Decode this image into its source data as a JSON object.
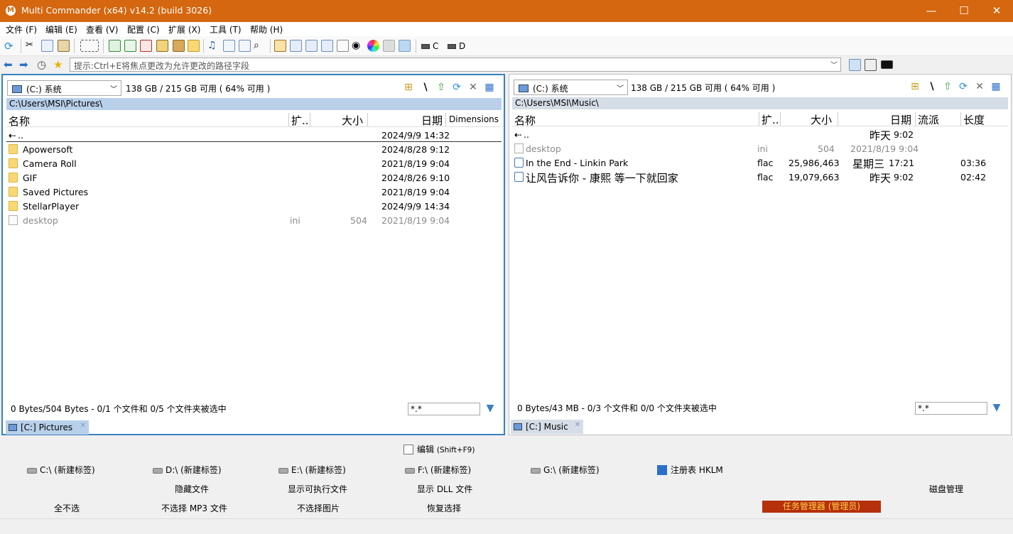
{
  "window": {
    "title": "Multi Commander (x64)  v14.2 (build 3026)",
    "app_icon": "M",
    "minimize": "—",
    "maximize": "☐",
    "close": "✕"
  },
  "menu": [
    "文件 (F)",
    "编辑 (E)",
    "查看 (V)",
    "配置 (C)",
    "扩展 (X)",
    "工具 (T)",
    "帮助 (H)"
  ],
  "toolbar": {
    "drive_c": "C",
    "drive_d": "D"
  },
  "address": {
    "placeholder": "提示:Ctrl+E将焦点更改为允许更改的路径字段",
    "dropdown": "﹀"
  },
  "left_panel": {
    "drive": "(C:) 系统",
    "space": "138 GB / 215 GB 可用 ( 64% 可用 )",
    "path": "C:\\Users\\MSI\\Pictures\\",
    "columns": {
      "name": "名称",
      "ext": "扩..",
      "size": "大小",
      "date": "日期",
      "dims": "Dimensions"
    },
    "rows": [
      {
        "name": "..",
        "ext": "",
        "size": "",
        "date": "2024/9/9 14:32",
        "kind": "up"
      },
      {
        "name": "Apowersoft",
        "ext": "",
        "size": "",
        "date": "2024/8/28 9:12",
        "kind": "folder"
      },
      {
        "name": "Camera Roll",
        "ext": "",
        "size": "",
        "date": "2021/8/19 9:04",
        "kind": "folder"
      },
      {
        "name": "GIF",
        "ext": "",
        "size": "",
        "date": "2024/8/26 9:10",
        "kind": "folder"
      },
      {
        "name": "Saved Pictures",
        "ext": "",
        "size": "",
        "date": "2021/8/19 9:04",
        "kind": "folder"
      },
      {
        "name": "StellarPlayer",
        "ext": "",
        "size": "",
        "date": "2024/9/9 14:34",
        "kind": "folder"
      },
      {
        "name": "desktop",
        "ext": "ini",
        "size": "504",
        "date": "2021/8/19 9:04",
        "kind": "ini"
      }
    ],
    "status": "0 Bytes/504 Bytes - 0/1 个文件和 0/5 个文件夹被选中",
    "filter": "*.*",
    "tab": "[C:] Pictures"
  },
  "right_panel": {
    "drive": "(C:) 系统",
    "space": "138 GB / 215 GB 可用 ( 64% 可用 )",
    "path": "C:\\Users\\MSI\\Music\\",
    "columns": {
      "name": "名称",
      "ext": "扩..",
      "size": "大小",
      "date": "日期",
      "genre": "流派",
      "length": "长度"
    },
    "rows": [
      {
        "name": "..",
        "ext": "",
        "size": "",
        "date_day": "昨天",
        "date_time": "9:02",
        "length": "",
        "kind": "up"
      },
      {
        "name": "desktop",
        "ext": "ini",
        "size": "504",
        "date_day": "",
        "date_time": "2021/8/19 9:04",
        "length": "",
        "kind": "ini"
      },
      {
        "name": "In the End - Linkin Park",
        "ext": "flac",
        "size": "25,986,463",
        "date_day": "星期三",
        "date_time": "17:21",
        "length": "03:36",
        "kind": "flac"
      },
      {
        "name": "让风告诉你 - 康熙 等一下就回家",
        "ext": "flac",
        "size": "19,079,663",
        "date_day": "昨天",
        "date_time": "9:02",
        "length": "02:42",
        "kind": "flac"
      }
    ],
    "status": "0 Bytes/43 MB - 0/3 个文件和 0/0 个文件夹被选中",
    "filter": "*.*",
    "tab": "[C:] Music"
  },
  "buttons": {
    "edit": "编辑",
    "edit_shortcut": "(Shift+F9)",
    "drives": [
      "C:\\ (新建标签)",
      "D:\\ (新建标签)",
      "E:\\ (新建标签)",
      "F:\\ (新建标签)",
      "G:\\ (新建标签)"
    ],
    "registry": "注册表 HKLM",
    "hide_files": "隐藏文件",
    "show_exe": "显示可执行文件",
    "show_dll": "显示 DLL 文件",
    "disk_mgmt": "磁盘管理",
    "select_none": "全不选",
    "deselect_mp3": "不选择 MP3 文件",
    "deselect_img": "不选择图片",
    "restore_sel": "恢复选择",
    "task_mgr": "任务管理器 (管理员)"
  },
  "colors": {
    "titlebar": "#d4670f",
    "active_border": "#3a80c3",
    "path_active": "#b9d0eb",
    "task_btn_bg": "#b5300b",
    "task_btn_fg": "#ffd34a"
  }
}
